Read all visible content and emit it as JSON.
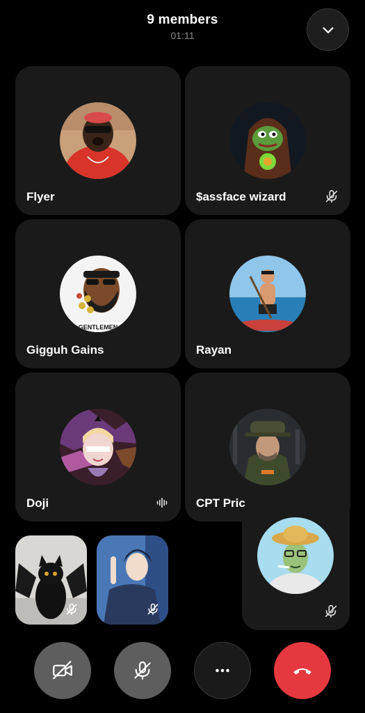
{
  "header": {
    "title": "9 members",
    "timer": "01:11"
  },
  "participants": [
    {
      "name": "Flyer"
    },
    {
      "name": "$assface wizard",
      "status_icon": "mic-off-icon"
    },
    {
      "name": "Gigguh Gains",
      "avatar_caption": "GENTLEMEN"
    },
    {
      "name": "Rayan"
    },
    {
      "name": "Doji",
      "status_icon": "speaking-icon"
    },
    {
      "name": "CPT Pric"
    }
  ],
  "mini_participants": [
    {
      "status_icon": "mic-off-icon"
    },
    {
      "status_icon": "mic-off-icon"
    }
  ],
  "self_view": {
    "status_icon": "mic-off-icon"
  },
  "controls": {
    "camera": "camera-off-icon",
    "mic": "mic-off-icon",
    "more": "more-icon",
    "end": "end-call-icon",
    "end_color": "#e5393f"
  }
}
